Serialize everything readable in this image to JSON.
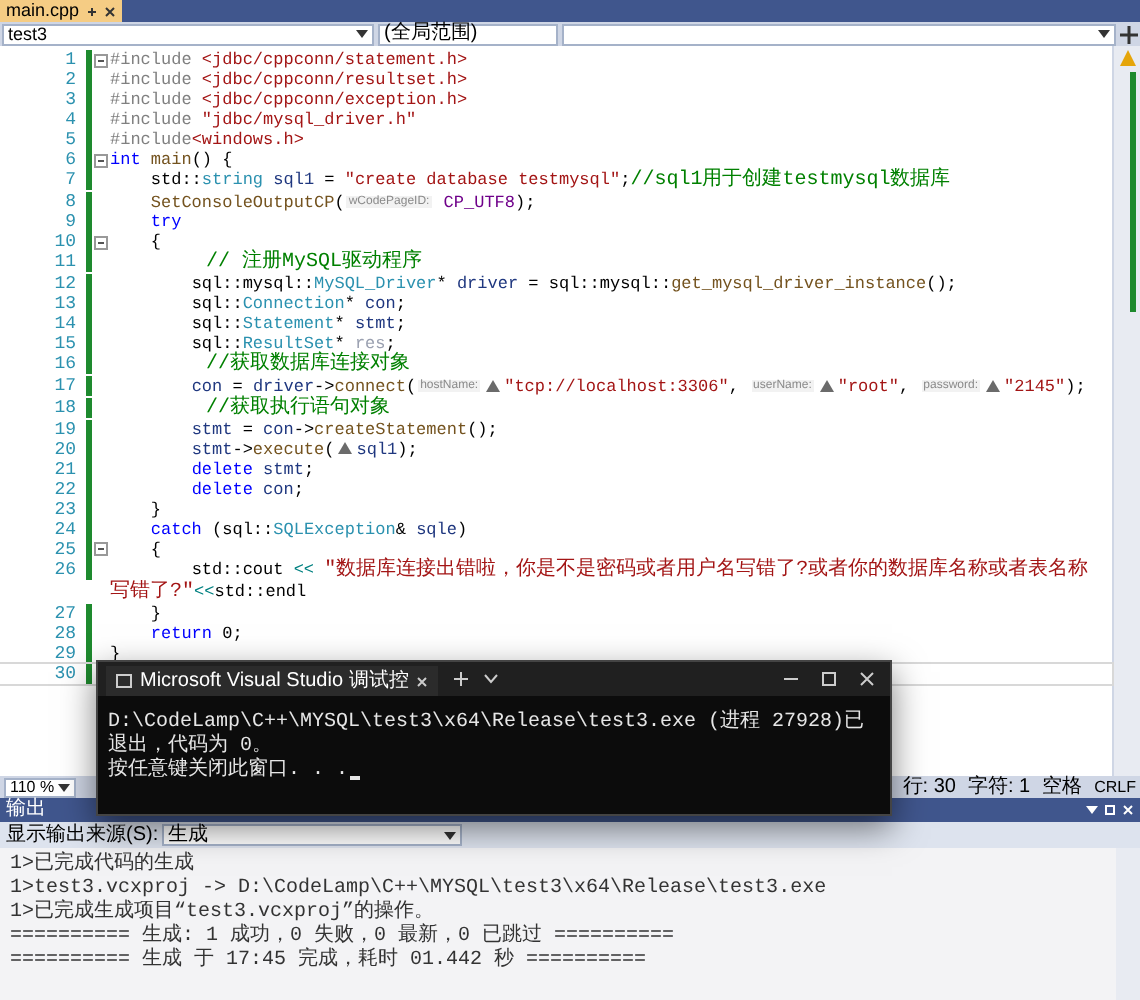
{
  "document_tab": {
    "label": "main.cpp",
    "selected": true
  },
  "navigation_bar": {
    "project": "test3",
    "scope": "(全局范围)"
  },
  "code_lines": [
    {
      "number": "1",
      "fold": true,
      "current": false,
      "tokens": [
        {
          "kind": "preprocessor",
          "text": "#include "
        },
        {
          "kind": "string",
          "text": "<jdbc/cppconn/statement.h>"
        }
      ]
    },
    {
      "number": "2",
      "fold": false,
      "current": false,
      "tokens": [
        {
          "kind": "preprocessor",
          "text": "#include "
        },
        {
          "kind": "string",
          "text": "<jdbc/cppconn/resultset.h>"
        }
      ]
    },
    {
      "number": "3",
      "fold": false,
      "current": false,
      "tokens": [
        {
          "kind": "preprocessor",
          "text": "#include "
        },
        {
          "kind": "string",
          "text": "<jdbc/cppconn/exception.h>"
        }
      ]
    },
    {
      "number": "4",
      "fold": false,
      "current": false,
      "tokens": [
        {
          "kind": "preprocessor",
          "text": "#include "
        },
        {
          "kind": "string",
          "text": "\"jdbc/mysql_driver.h\""
        }
      ]
    },
    {
      "number": "5",
      "fold": false,
      "current": false,
      "tokens": [
        {
          "kind": "preprocessor",
          "text": "#include"
        },
        {
          "kind": "string",
          "text": "<windows.h>"
        }
      ]
    },
    {
      "number": "6",
      "fold": true,
      "current": false,
      "tokens": [
        {
          "kind": "keyword",
          "text": "int "
        },
        {
          "kind": "function",
          "text": "main"
        },
        {
          "kind": "plain",
          "text": "() {"
        }
      ]
    },
    {
      "number": "7",
      "fold": false,
      "current": false,
      "tokens": [
        {
          "kind": "plain",
          "text": "    std::"
        },
        {
          "kind": "type",
          "text": "string "
        },
        {
          "kind": "variable",
          "text": "sql1"
        },
        {
          "kind": "plain",
          "text": " = "
        },
        {
          "kind": "string",
          "text": "\"create database testmysql\""
        },
        {
          "kind": "plain",
          "text": ";"
        },
        {
          "kind": "comment",
          "text": "//sql1用于创建testmysql数据库"
        }
      ]
    },
    {
      "number": "8",
      "fold": false,
      "current": false,
      "tokens": [
        {
          "kind": "function",
          "text": "    SetConsoleOutputCP"
        },
        {
          "kind": "plain",
          "text": "("
        },
        {
          "kind": "hint",
          "text": "wCodePageID:"
        },
        {
          "kind": "macro",
          "text": " CP_UTF8"
        },
        {
          "kind": "plain",
          "text": ");"
        }
      ]
    },
    {
      "number": "9",
      "fold": false,
      "current": false,
      "tokens": [
        {
          "kind": "keyword",
          "text": "    try"
        }
      ]
    },
    {
      "number": "10",
      "fold": true,
      "current": false,
      "tokens": [
        {
          "kind": "plain",
          "text": "    {"
        }
      ]
    },
    {
      "number": "11",
      "fold": false,
      "current": false,
      "tokens": [
        {
          "kind": "comment",
          "text": "        // 注册MySQL驱动程序"
        }
      ]
    },
    {
      "number": "12",
      "fold": false,
      "current": false,
      "tokens": [
        {
          "kind": "plain",
          "text": "        sql::mysql::"
        },
        {
          "kind": "type",
          "text": "MySQL_Driver"
        },
        {
          "kind": "plain",
          "text": "* "
        },
        {
          "kind": "variable",
          "text": "driver"
        },
        {
          "kind": "plain",
          "text": " = sql::mysql::"
        },
        {
          "kind": "function",
          "text": "get_mysql_driver_instance"
        },
        {
          "kind": "plain",
          "text": "();"
        }
      ]
    },
    {
      "number": "13",
      "fold": false,
      "current": false,
      "tokens": [
        {
          "kind": "plain",
          "text": "        sql::"
        },
        {
          "kind": "type",
          "text": "Connection"
        },
        {
          "kind": "plain",
          "text": "* "
        },
        {
          "kind": "variable",
          "text": "con"
        },
        {
          "kind": "plain",
          "text": ";"
        }
      ]
    },
    {
      "number": "14",
      "fold": false,
      "current": false,
      "tokens": [
        {
          "kind": "plain",
          "text": "        sql::"
        },
        {
          "kind": "type",
          "text": "Statement"
        },
        {
          "kind": "plain",
          "text": "* "
        },
        {
          "kind": "variable",
          "text": "stmt"
        },
        {
          "kind": "plain",
          "text": ";"
        }
      ]
    },
    {
      "number": "15",
      "fold": false,
      "current": false,
      "tokens": [
        {
          "kind": "plain",
          "text": "        sql::"
        },
        {
          "kind": "type",
          "text": "ResultSet"
        },
        {
          "kind": "plain",
          "text": "* "
        },
        {
          "kind": "unused",
          "text": "res"
        },
        {
          "kind": "plain",
          "text": ";"
        }
      ]
    },
    {
      "number": "16",
      "fold": false,
      "current": false,
      "tokens": [
        {
          "kind": "comment",
          "text": "        //获取数据库连接对象"
        }
      ]
    },
    {
      "number": "17",
      "fold": false,
      "current": false,
      "tokens": [
        {
          "kind": "variable",
          "text": "        con"
        },
        {
          "kind": "plain",
          "text": " = "
        },
        {
          "kind": "variable",
          "text": "driver"
        },
        {
          "kind": "plain",
          "text": "->"
        },
        {
          "kind": "function",
          "text": "connect"
        },
        {
          "kind": "plain",
          "text": "("
        },
        {
          "kind": "hint",
          "text": "hostName:"
        },
        {
          "kind": "ref"
        },
        {
          "kind": "string",
          "text": "\"tcp://localhost:3306\""
        },
        {
          "kind": "plain",
          "text": ", "
        },
        {
          "kind": "hint",
          "text": "userName:"
        },
        {
          "kind": "ref"
        },
        {
          "kind": "string",
          "text": "\"root\""
        },
        {
          "kind": "plain",
          "text": ", "
        },
        {
          "kind": "hint",
          "text": "password:"
        },
        {
          "kind": "ref"
        },
        {
          "kind": "string",
          "text": "\"2145\""
        },
        {
          "kind": "plain",
          "text": ");"
        }
      ]
    },
    {
      "number": "18",
      "fold": false,
      "current": false,
      "tokens": [
        {
          "kind": "comment",
          "text": "        //获取执行语句对象"
        }
      ]
    },
    {
      "number": "19",
      "fold": false,
      "current": false,
      "tokens": [
        {
          "kind": "variable",
          "text": "        stmt"
        },
        {
          "kind": "plain",
          "text": " = "
        },
        {
          "kind": "variable",
          "text": "con"
        },
        {
          "kind": "plain",
          "text": "->"
        },
        {
          "kind": "function",
          "text": "createStatement"
        },
        {
          "kind": "plain",
          "text": "();"
        }
      ]
    },
    {
      "number": "20",
      "fold": false,
      "current": false,
      "tokens": [
        {
          "kind": "variable",
          "text": "        stmt"
        },
        {
          "kind": "plain",
          "text": "->"
        },
        {
          "kind": "function",
          "text": "execute"
        },
        {
          "kind": "plain",
          "text": "("
        },
        {
          "kind": "ref"
        },
        {
          "kind": "variable",
          "text": "sql1"
        },
        {
          "kind": "plain",
          "text": ");"
        }
      ]
    },
    {
      "number": "21",
      "fold": false,
      "current": false,
      "tokens": [
        {
          "kind": "keyword",
          "text": "        delete "
        },
        {
          "kind": "variable",
          "text": "stmt"
        },
        {
          "kind": "plain",
          "text": ";"
        }
      ]
    },
    {
      "number": "22",
      "fold": false,
      "current": false,
      "tokens": [
        {
          "kind": "keyword",
          "text": "        delete "
        },
        {
          "kind": "variable",
          "text": "con"
        },
        {
          "kind": "plain",
          "text": ";"
        }
      ]
    },
    {
      "number": "23",
      "fold": false,
      "current": false,
      "tokens": [
        {
          "kind": "plain",
          "text": "    }"
        }
      ]
    },
    {
      "number": "24",
      "fold": false,
      "current": false,
      "tokens": [
        {
          "kind": "keyword",
          "text": "    catch"
        },
        {
          "kind": "plain",
          "text": " (sql::"
        },
        {
          "kind": "type",
          "text": "SQLException"
        },
        {
          "kind": "plain",
          "text": "& "
        },
        {
          "kind": "variable",
          "text": "sqle"
        },
        {
          "kind": "plain",
          "text": ")"
        }
      ]
    },
    {
      "number": "25",
      "fold": true,
      "current": false,
      "tokens": [
        {
          "kind": "plain",
          "text": "    {"
        }
      ]
    },
    {
      "number": "26",
      "fold": false,
      "current": false,
      "tokens": [
        {
          "kind": "plain",
          "text": "        std::cout "
        },
        {
          "kind": "operator",
          "text": "<< "
        },
        {
          "kind": "string",
          "text": "\"数据库连接出错啦，你是不是密码或者用户名写错了?或者你的数据库名称或者表名称写错了?\""
        },
        {
          "kind": "operator",
          "text": "<<"
        },
        {
          "kind": "plain",
          "text": "std::endl"
        }
      ]
    },
    {
      "number": "27",
      "fold": false,
      "current": false,
      "tokens": [
        {
          "kind": "plain",
          "text": "    }"
        }
      ]
    },
    {
      "number": "28",
      "fold": false,
      "current": false,
      "tokens": [
        {
          "kind": "keyword",
          "text": "    return"
        },
        {
          "kind": "plain",
          "text": " 0;"
        }
      ]
    },
    {
      "number": "29",
      "fold": false,
      "current": false,
      "tokens": [
        {
          "kind": "plain",
          "text": "}"
        }
      ]
    },
    {
      "number": "30",
      "fold": false,
      "current": true
    }
  ],
  "editor_status": {
    "zoom": "110 %",
    "line": "行: 30",
    "char": "字符: 1",
    "whitespace": "空格",
    "line_ending": "CRLF"
  },
  "console": {
    "title": "Microsoft Visual Studio 调试控",
    "lines": [
      "D:\\CodeLamp\\C++\\MYSQL\\test3\\x64\\Release\\test3.exe (进程 27928)已",
      "退出，代码为 0。",
      "按任意键关闭此窗口. . ."
    ]
  },
  "output_panel": {
    "title": "输出",
    "source_label": "显示输出来源(S):",
    "source": "生成",
    "lines": [
      "1>已完成代码的生成",
      "1>test3.vcxproj -> D:\\CodeLamp\\C++\\MYSQL\\test3\\x64\\Release\\test3.exe",
      "1>已完成生成项目“test3.vcxproj”的操作。",
      "========== 生成: 1 成功，0 失败，0 最新，0 已跳过 ==========",
      "========== 生成 于 17:45 完成，耗时 01.442 秒 =========="
    ]
  }
}
